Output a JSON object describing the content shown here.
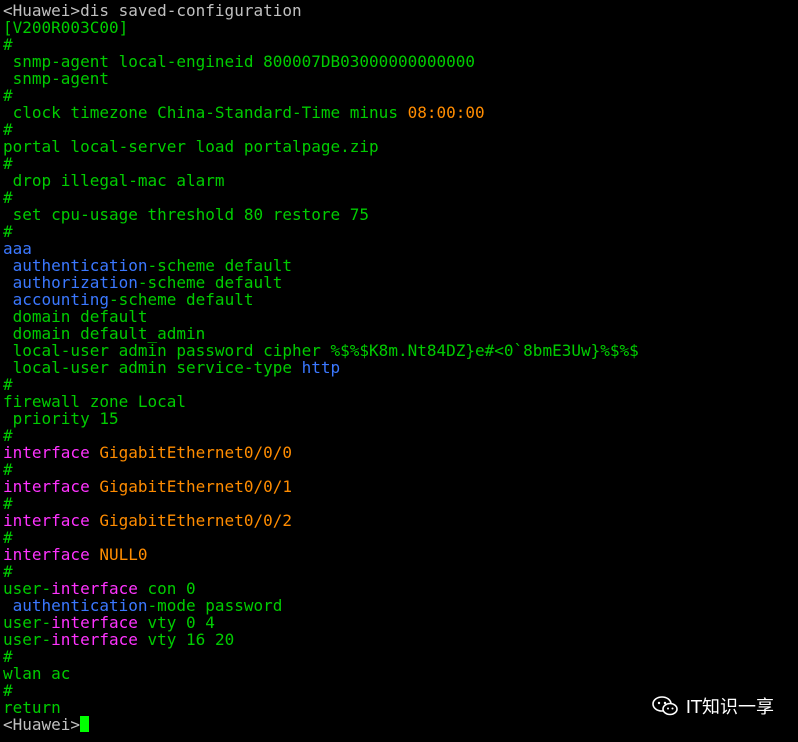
{
  "colors": {
    "background": "#000000",
    "default_text": "#c0c0c0",
    "green": "#00cc00",
    "blue": "#3b78ff",
    "orange": "#ff8c00",
    "magenta": "#ff33ff",
    "cursor": "#00ff00"
  },
  "lines": [
    [
      {
        "t": "<Huawei>dis saved-configuration",
        "c": "white"
      }
    ],
    [
      {
        "t": "[V200R003C00]",
        "c": "green"
      }
    ],
    [
      {
        "t": "#",
        "c": "green"
      }
    ],
    [
      {
        "t": " snmp-agent local-engineid 800007DB03000000000000",
        "c": "green"
      }
    ],
    [
      {
        "t": " snmp-agent",
        "c": "green"
      }
    ],
    [
      {
        "t": "#",
        "c": "green"
      }
    ],
    [
      {
        "t": " clock timezone China-Standard-Time minus ",
        "c": "green"
      },
      {
        "t": "08:00:00",
        "c": "orange"
      }
    ],
    [
      {
        "t": "#",
        "c": "green"
      }
    ],
    [
      {
        "t": "portal local-server load portalpage.zip",
        "c": "green"
      }
    ],
    [
      {
        "t": "#",
        "c": "green"
      }
    ],
    [
      {
        "t": " drop illegal-mac alarm",
        "c": "green"
      }
    ],
    [
      {
        "t": "#",
        "c": "green"
      }
    ],
    [
      {
        "t": " set cpu-usage threshold 80 restore 75",
        "c": "green"
      }
    ],
    [
      {
        "t": "#",
        "c": "green"
      }
    ],
    [
      {
        "t": "aaa",
        "c": "blue"
      }
    ],
    [
      {
        "t": " authentication",
        "c": "blue"
      },
      {
        "t": "-scheme default",
        "c": "green"
      }
    ],
    [
      {
        "t": " authorization",
        "c": "blue"
      },
      {
        "t": "-scheme default",
        "c": "green"
      }
    ],
    [
      {
        "t": " accounting",
        "c": "blue"
      },
      {
        "t": "-scheme default",
        "c": "green"
      }
    ],
    [
      {
        "t": " domain default",
        "c": "green"
      }
    ],
    [
      {
        "t": " domain default_admin",
        "c": "green"
      }
    ],
    [
      {
        "t": " local-user admin password cipher %$%$K8m.Nt84DZ}e#<0`8bmE3Uw}%$%$",
        "c": "green"
      }
    ],
    [
      {
        "t": " local-user admin service-type ",
        "c": "green"
      },
      {
        "t": "http",
        "c": "blue"
      }
    ],
    [
      {
        "t": "#",
        "c": "green"
      }
    ],
    [
      {
        "t": "firewall zone Local",
        "c": "green"
      }
    ],
    [
      {
        "t": " priority 15",
        "c": "green"
      }
    ],
    [
      {
        "t": "#",
        "c": "green"
      }
    ],
    [
      {
        "t": "interface ",
        "c": "magenta"
      },
      {
        "t": "GigabitEthernet0/0/0",
        "c": "orange"
      }
    ],
    [
      {
        "t": "#",
        "c": "green"
      }
    ],
    [
      {
        "t": "interface ",
        "c": "magenta"
      },
      {
        "t": "GigabitEthernet0/0/1",
        "c": "orange"
      }
    ],
    [
      {
        "t": "#",
        "c": "green"
      }
    ],
    [
      {
        "t": "interface ",
        "c": "magenta"
      },
      {
        "t": "GigabitEthernet0/0/2",
        "c": "orange"
      }
    ],
    [
      {
        "t": "#",
        "c": "green"
      }
    ],
    [
      {
        "t": "interface ",
        "c": "magenta"
      },
      {
        "t": "NULL0",
        "c": "orange"
      }
    ],
    [
      {
        "t": "#",
        "c": "green"
      }
    ],
    [
      {
        "t": "user-",
        "c": "green"
      },
      {
        "t": "interface",
        "c": "magenta"
      },
      {
        "t": " con 0",
        "c": "green"
      }
    ],
    [
      {
        "t": " authentication",
        "c": "blue"
      },
      {
        "t": "-mode password",
        "c": "green"
      }
    ],
    [
      {
        "t": "user-",
        "c": "green"
      },
      {
        "t": "interface",
        "c": "magenta"
      },
      {
        "t": " vty 0 4",
        "c": "green"
      }
    ],
    [
      {
        "t": "user-",
        "c": "green"
      },
      {
        "t": "interface",
        "c": "magenta"
      },
      {
        "t": " vty 16 20",
        "c": "green"
      }
    ],
    [
      {
        "t": "#",
        "c": "green"
      }
    ],
    [
      {
        "t": "wlan ac",
        "c": "green"
      }
    ],
    [
      {
        "t": "#",
        "c": "green"
      }
    ],
    [
      {
        "t": "return",
        "c": "green"
      }
    ],
    [
      {
        "t": "<Huawei>",
        "c": "white"
      }
    ]
  ],
  "watermark": {
    "icon": "wechat-icon",
    "text": "IT知识一享"
  }
}
